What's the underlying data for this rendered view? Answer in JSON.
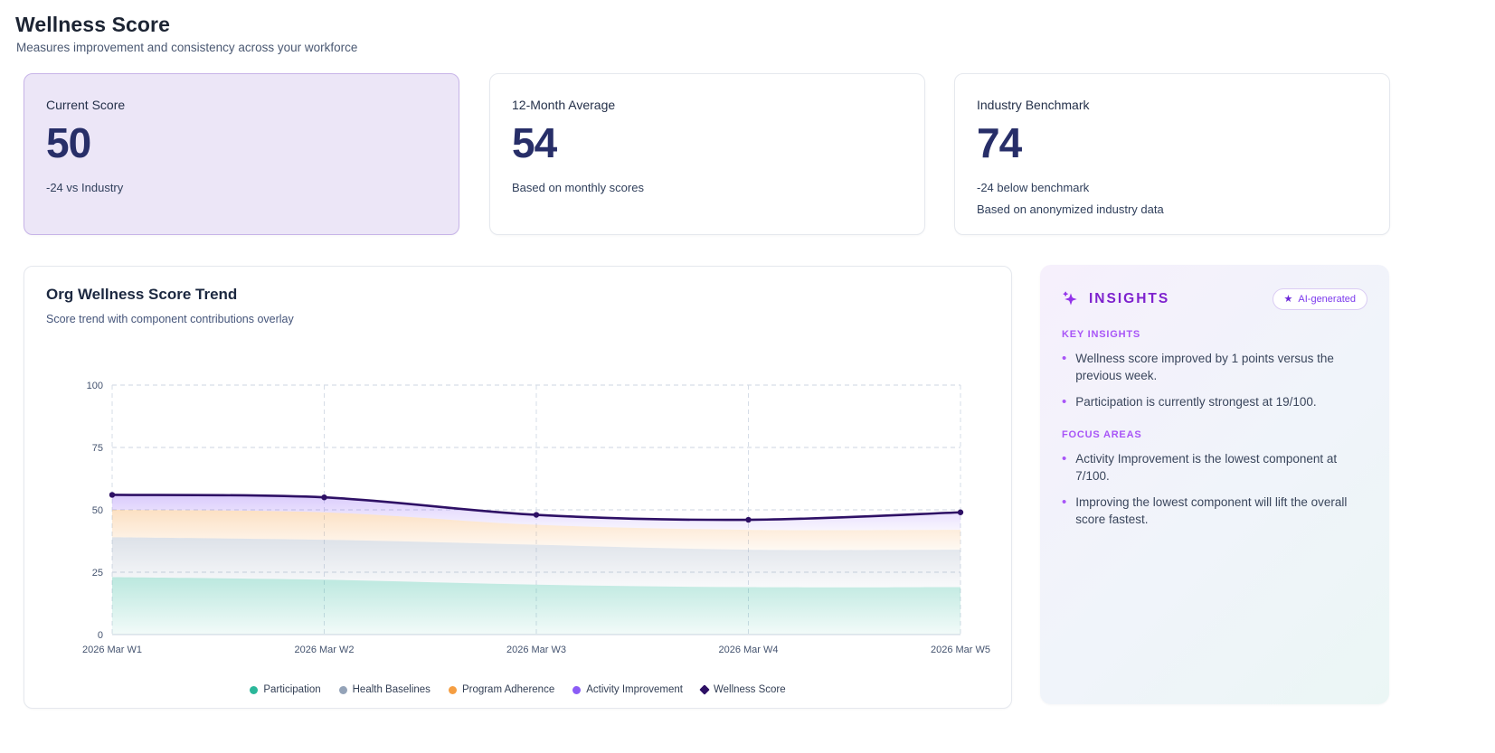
{
  "page": {
    "title": "Wellness Score",
    "subtitle": "Measures improvement and consistency across your workforce"
  },
  "stat_cards": [
    {
      "label": "Current Score",
      "value": "50",
      "note": "-24 vs Industry",
      "highlighted": true
    },
    {
      "label": "12-Month Average",
      "value": "54",
      "note": "Based on monthly scores",
      "highlighted": false
    },
    {
      "label": "Industry Benchmark",
      "value": "74",
      "note": "-24 below benchmark",
      "note2": "Based on anonymized industry data",
      "highlighted": false
    }
  ],
  "chart_card": {
    "title": "Org Wellness Score Trend",
    "subtitle": "Score trend with component contributions overlay"
  },
  "chart_data": {
    "type": "area",
    "title": "Org Wellness Score Trend",
    "x": [
      "2026 Mar W1",
      "2026 Mar W2",
      "2026 Mar W3",
      "2026 Mar W4",
      "2026 Mar W5"
    ],
    "stacked_series": [
      {
        "name": "Participation",
        "color": "#2bb79a",
        "values": [
          23,
          22,
          20,
          19,
          19
        ]
      },
      {
        "name": "Health Baselines",
        "color": "#94a3b8",
        "values": [
          16,
          16,
          16,
          15,
          15
        ]
      },
      {
        "name": "Program Adherence",
        "color": "#f59e42",
        "values": [
          11,
          11,
          8,
          8,
          8
        ]
      },
      {
        "name": "Activity Improvement",
        "color": "#8b5cf6",
        "values": [
          6,
          6,
          4,
          4,
          7
        ]
      }
    ],
    "line_series": {
      "name": "Wellness Score",
      "color": "#2e1065",
      "values": [
        56,
        55,
        48,
        46,
        49
      ]
    },
    "ylim": [
      0,
      100
    ],
    "yticks": [
      0,
      25,
      50,
      75,
      100
    ],
    "grid": "dashed",
    "legend_position": "bottom"
  },
  "insights": {
    "title": "INSIGHTS",
    "badge_label": "AI-generated",
    "sections": [
      {
        "heading": "KEY INSIGHTS",
        "bullets": [
          "Wellness score improved by 1 points versus the previous week.",
          "Participation is currently strongest at 19/100."
        ]
      },
      {
        "heading": "FOCUS AREAS",
        "bullets": [
          "Activity Improvement is the lowest component at 7/100.",
          "Improving the lowest component will lift the overall score fastest."
        ]
      }
    ]
  },
  "colors": {
    "insights_accent": "#7e22ce",
    "section_heading": "#a855f7",
    "stat_value": "#272e68",
    "highlight_card_bg": "#ece6f7",
    "highlight_card_border": "#c7b4e8",
    "card_border": "#e5e8ee",
    "axis_label": "#44536f"
  }
}
